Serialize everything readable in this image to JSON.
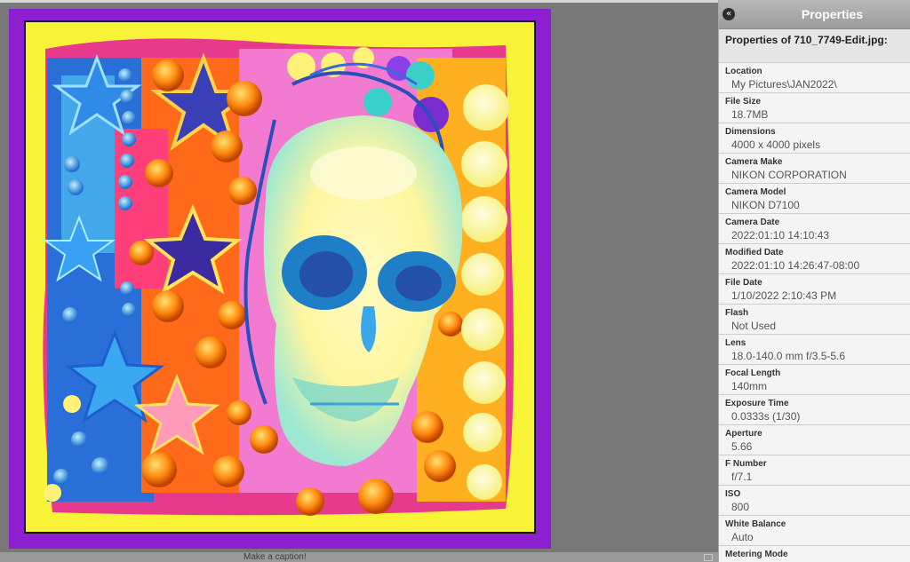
{
  "caption": {
    "placeholder_text": "Make a caption!"
  },
  "panel": {
    "title": "Properties",
    "collapse_icon": "double-chevron-left-icon",
    "file_heading": "Properties of 710_7749-Edit.jpg:",
    "properties": [
      {
        "label": "Location",
        "value": "My Pictures\\JAN2022\\"
      },
      {
        "label": "File Size",
        "value": "18.7MB"
      },
      {
        "label": "Dimensions",
        "value": "4000 x 4000 pixels"
      },
      {
        "label": "Camera Make",
        "value": "NIKON CORPORATION"
      },
      {
        "label": "Camera Model",
        "value": "NIKON D7100"
      },
      {
        "label": "Camera Date",
        "value": "2022:01:10 14:10:43"
      },
      {
        "label": "Modified Date",
        "value": "2022:01:10 14:26:47-08:00"
      },
      {
        "label": "File Date",
        "value": "1/10/2022 2:10:43 PM"
      },
      {
        "label": "Flash",
        "value": "Not Used"
      },
      {
        "label": "Lens",
        "value": "18.0-140.0 mm f/3.5-5.6"
      },
      {
        "label": "Focal Length",
        "value": "140mm"
      },
      {
        "label": "Exposure Time",
        "value": "0.0333s (1/30)"
      },
      {
        "label": "Aperture",
        "value": "5.66"
      },
      {
        "label": "F Number",
        "value": "f/7.1"
      },
      {
        "label": "ISO",
        "value": "800"
      },
      {
        "label": "White Balance",
        "value": "Auto"
      },
      {
        "label": "Metering Mode",
        "value": ""
      }
    ]
  },
  "colors": {
    "frame_border": "#8c1fd0",
    "mat": "#f8f338",
    "panel_header": "#a8a8a8"
  }
}
